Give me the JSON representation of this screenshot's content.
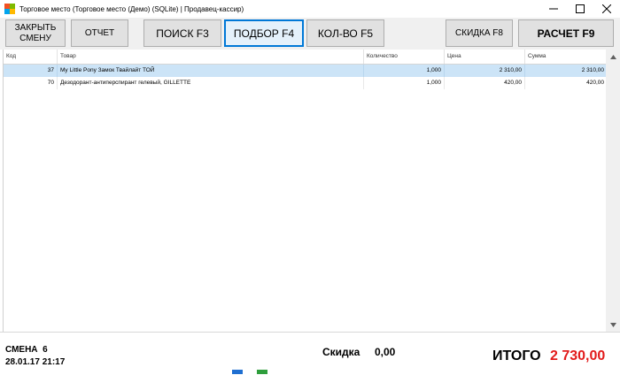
{
  "window": {
    "title": "Торговое место (Торговое место (Демо) (SQLite) | Продавец-кассир)",
    "controls": [
      "minimize",
      "maximize",
      "close"
    ]
  },
  "toolbar": {
    "close_shift_line1": "ЗАКРЫТЬ",
    "close_shift_line2": "СМЕНУ",
    "report": "ОТЧЕТ",
    "search": "ПОИСК F3",
    "selection": "ПОДБОР F4",
    "quantity": "КОЛ-ВО F5",
    "discount": "СКИДКА F8",
    "checkout": "РАСЧЕТ F9"
  },
  "table": {
    "columns": [
      "Код",
      "Товар",
      "Количество",
      "Цена",
      "Сумма"
    ],
    "rows": [
      {
        "code": "37",
        "product": "My Little Pony Замок Твайлайт ТОЙ",
        "qty": "1,000",
        "price": "2 310,00",
        "sum": "2 310,00",
        "selected": true
      },
      {
        "code": "70",
        "product": "Дезодорант-антиперспирант гелевый,  GILLETTE",
        "qty": "1,000",
        "price": "420,00",
        "sum": "420,00",
        "selected": false
      }
    ]
  },
  "footer": {
    "shift_label": "СМЕНА",
    "shift_number": "6",
    "datetime": "28.01.17 21:17",
    "discount_label": "Скидка",
    "discount_value": "0,00",
    "total_label": "ИТОГО",
    "total_value": "2 730,00"
  },
  "colors": {
    "total_value": "#e21b1b",
    "selected_row": "#cce4f7",
    "active_button_border": "#0078d7"
  }
}
